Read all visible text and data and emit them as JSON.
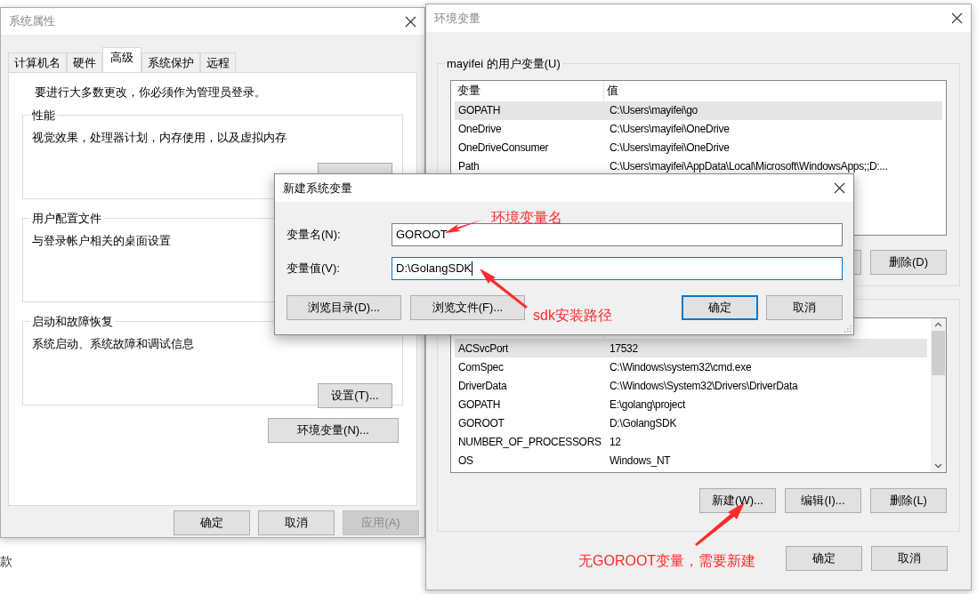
{
  "background_text": "款",
  "system_properties": {
    "title": "系统属性",
    "tabs": [
      {
        "label": "计算机名",
        "selected": false
      },
      {
        "label": "硬件",
        "selected": false
      },
      {
        "label": "高级",
        "selected": true
      },
      {
        "label": "系统保护",
        "selected": false
      },
      {
        "label": "远程",
        "selected": false
      }
    ],
    "notice": "要进行大多数更改，你必须作为管理员登录。",
    "groups": [
      {
        "title": "性能",
        "description": "视觉效果，处理器计划，内存使用，以及虚拟内存"
      },
      {
        "title": "用户配置文件",
        "description": "与登录帐户相关的桌面设置"
      },
      {
        "title": "启动和故障恢复",
        "description": "系统启动、系统故障和调试信息",
        "button": "设置(T)..."
      }
    ],
    "env_button": "环境变量(N)...",
    "buttons": [
      {
        "label": "确定",
        "disabled": false
      },
      {
        "label": "取消",
        "disabled": false
      },
      {
        "label": "应用(A)",
        "disabled": true
      }
    ]
  },
  "environment_variables": {
    "title": "环境变量",
    "user_group_title": "mayifei 的用户变量(U)",
    "user_columns": [
      "变量",
      "值"
    ],
    "user_rows": [
      {
        "name": "GOPATH",
        "value": "C:\\Users\\mayifei\\go",
        "selected": true
      },
      {
        "name": "OneDrive",
        "value": "C:\\Users\\mayifei\\OneDrive",
        "selected": false
      },
      {
        "name": "OneDriveConsumer",
        "value": "C:\\Users\\mayifei\\OneDrive",
        "selected": false
      },
      {
        "name": "Path",
        "value": "C:\\Users\\mayifei\\AppData\\Local\\Microsoft\\WindowsApps;;D:...",
        "selected": false
      }
    ],
    "user_delete_button": "删除(D)",
    "system_rows": [
      {
        "name": "ACSvcPort",
        "value": "17532",
        "selected": true
      },
      {
        "name": "ComSpec",
        "value": "C:\\Windows\\system32\\cmd.exe",
        "selected": false
      },
      {
        "name": "DriverData",
        "value": "C:\\Windows\\System32\\Drivers\\DriverData",
        "selected": false
      },
      {
        "name": "GOPATH",
        "value": "E:\\golang\\project",
        "selected": false
      },
      {
        "name": "GOROOT",
        "value": "D:\\GolangSDK",
        "selected": false
      },
      {
        "name": "NUMBER_OF_PROCESSORS",
        "value": "12",
        "selected": false
      },
      {
        "name": "OS",
        "value": "Windows_NT",
        "selected": false
      }
    ],
    "system_buttons": [
      "新建(W)...",
      "编辑(I)...",
      "删除(L)"
    ],
    "buttons": [
      "确定",
      "取消"
    ]
  },
  "new_variable_dialog": {
    "title": "新建系统变量",
    "fields": [
      {
        "label": "变量名(N):",
        "value": "GOROOT",
        "focused": false
      },
      {
        "label": "变量值(V):",
        "value": "D:\\GolangSDK",
        "focused": true
      }
    ],
    "browse_buttons": [
      "浏览目录(D)...",
      "浏览文件(F)..."
    ],
    "buttons": [
      {
        "label": "确定",
        "default": true
      },
      {
        "label": "取消",
        "default": false
      }
    ]
  },
  "annotations": [
    {
      "text": "环境变量名"
    },
    {
      "text": "sdk安装路径"
    },
    {
      "text": "无GOROOT变量，需要新建"
    }
  ]
}
